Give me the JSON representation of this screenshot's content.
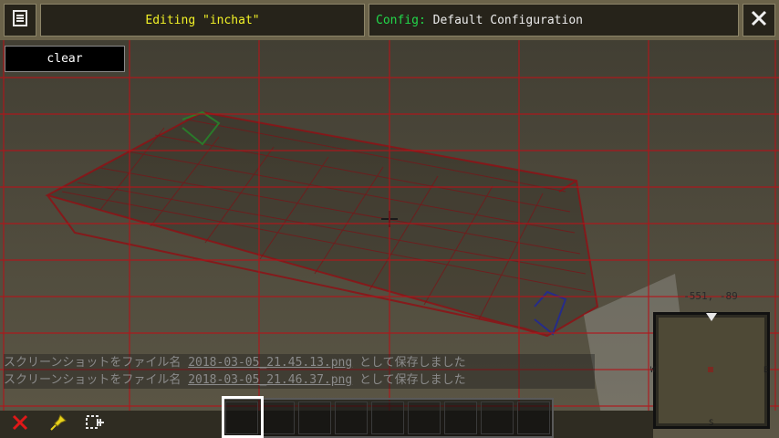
{
  "header": {
    "editing_title": "Editing \"inchat\"",
    "config_label": "Config:",
    "config_value": "Default Configuration"
  },
  "toolbar": {
    "clear_label": "clear"
  },
  "chat": [
    {
      "prefix": "スクリーンショットをファイル名 ",
      "file": "2018-03-05_21.45.13.png",
      "suffix": " として保存しました"
    },
    {
      "prefix": "スクリーンショットをファイル名 ",
      "file": "2018-03-05_21.46.37.png",
      "suffix": " として保存しました"
    }
  ],
  "minimap": {
    "coords": "-551, -89",
    "north": "N",
    "south": "S",
    "east": "E",
    "west": "W"
  },
  "colors": {
    "editing_title": "#f2f227",
    "config_label": "#22d84a",
    "grid_overlay": "#b3141a",
    "selection_outline": "#7a0f14"
  },
  "icons": [
    "menu-icon",
    "close-icon",
    "remove-icon",
    "pin-icon",
    "add-element-icon"
  ]
}
